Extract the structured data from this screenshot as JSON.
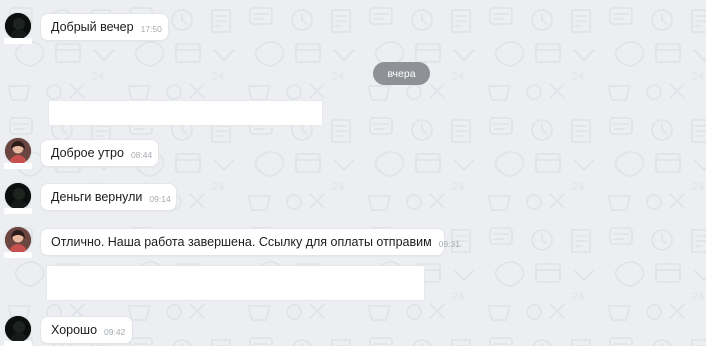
{
  "chat": {
    "date_divider": "вчера",
    "messages": [
      {
        "text": "Добрый вечер",
        "time": "17:50"
      },
      {
        "text": "Доброе утро",
        "time": "08:44"
      },
      {
        "text": "Деньги вернули",
        "time": "09:14"
      },
      {
        "text": "Отлично. Наша работа завершена. Ссылку для оплаты отправим",
        "time": "09:31"
      },
      {
        "text": "Хорошо",
        "time": "09:42"
      }
    ]
  },
  "colors": {
    "background": "#eceef1",
    "bubble": "#ffffff",
    "date_pill": "#8e9196",
    "timestamp": "#a6abb0"
  },
  "icons": [
    "contact-avatar-dark",
    "contact-avatar-photo"
  ]
}
